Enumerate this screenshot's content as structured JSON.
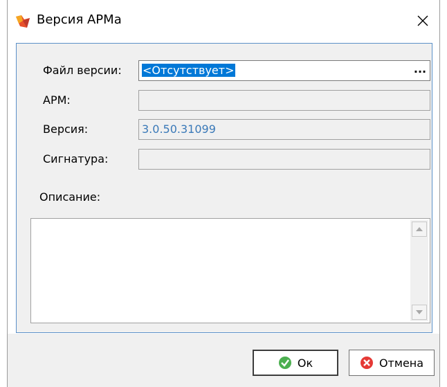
{
  "window": {
    "title": "Версия АРМа",
    "icons": {
      "app": "app-icon",
      "close": "close-icon"
    }
  },
  "form": {
    "file_label": "Файл версии:",
    "file_value": "<Отсутствует>",
    "browse_label": "...",
    "arm_label": "АРМ:",
    "arm_value": "",
    "version_label": "Версия:",
    "version_value": "3.0.50.31099",
    "signature_label": "Сигнатура:",
    "signature_value": "",
    "description_label": "Описание:",
    "description_value": ""
  },
  "buttons": {
    "ok_label": "Ок",
    "cancel_label": "Отмена",
    "ok_icon": "checkmark-icon",
    "cancel_icon": "cross-icon"
  },
  "colors": {
    "selection": "#0078d7",
    "version_text": "#3a79b8",
    "frame_border": "#5a90c8"
  }
}
